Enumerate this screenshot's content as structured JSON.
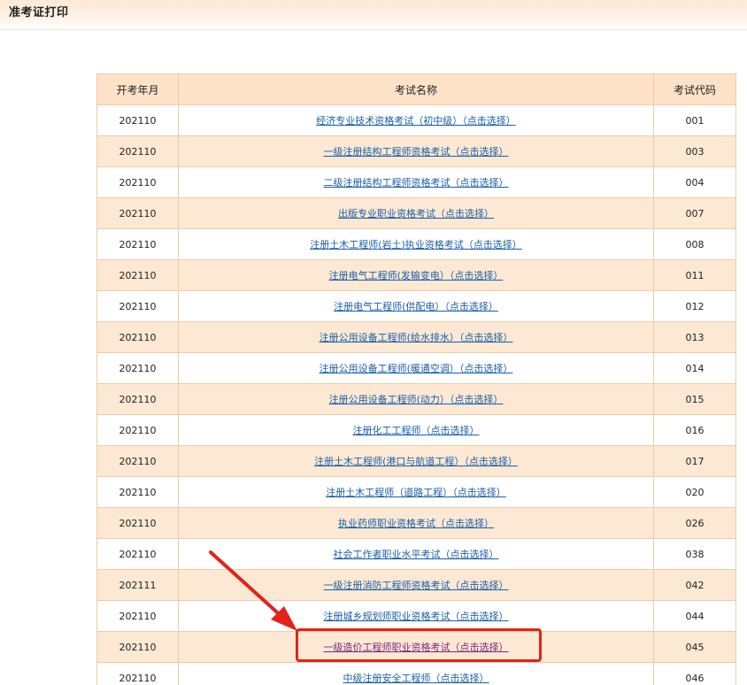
{
  "page": {
    "title": "准考证打印"
  },
  "table": {
    "headers": {
      "month": "开考年月",
      "name": "考试名称",
      "code": "考试代码"
    },
    "rows": [
      {
        "month": "202110",
        "name": "经济专业技术资格考试（初中级）（点击选择）",
        "code": "001"
      },
      {
        "month": "202110",
        "name": "一级注册结构工程师资格考试（点击选择）",
        "code": "003"
      },
      {
        "month": "202110",
        "name": "二级注册结构工程师资格考试（点击选择）",
        "code": "004"
      },
      {
        "month": "202110",
        "name": "出版专业职业资格考试（点击选择）",
        "code": "007"
      },
      {
        "month": "202110",
        "name": "注册土木工程师(岩土)执业资格考试（点击选择）",
        "code": "008"
      },
      {
        "month": "202110",
        "name": "注册电气工程师(发输变电）（点击选择）",
        "code": "011"
      },
      {
        "month": "202110",
        "name": "注册电气工程师(供配电）（点击选择）",
        "code": "012"
      },
      {
        "month": "202110",
        "name": "注册公用设备工程师(给水排水）（点击选择）",
        "code": "013"
      },
      {
        "month": "202110",
        "name": "注册公用设备工程师(暖通空调）（点击选择）",
        "code": "014"
      },
      {
        "month": "202110",
        "name": "注册公用设备工程师(动力）（点击选择）",
        "code": "015"
      },
      {
        "month": "202110",
        "name": "注册化工工程师（点击选择）",
        "code": "016"
      },
      {
        "month": "202110",
        "name": "注册土木工程师(港口与航道工程）（点击选择）",
        "code": "017"
      },
      {
        "month": "202110",
        "name": "注册土木工程师（道路工程）（点击选择）",
        "code": "020"
      },
      {
        "month": "202110",
        "name": "执业药师职业资格考试（点击选择）",
        "code": "026"
      },
      {
        "month": "202110",
        "name": "社会工作者职业水平考试（点击选择）",
        "code": "038"
      },
      {
        "month": "202111",
        "name": "一级注册消防工程师资格考试（点击选择）",
        "code": "042"
      },
      {
        "month": "202110",
        "name": "注册城乡规划师职业资格考试（点击选择）",
        "code": "044"
      },
      {
        "month": "202110",
        "name": "一级造价工程师职业资格考试（点击选择）",
        "code": "045"
      },
      {
        "month": "202110",
        "name": "中级注册安全工程师（点击选择）",
        "code": "046"
      }
    ]
  },
  "annotation": {
    "highlighted_code": "045",
    "color": "#e2231a"
  },
  "colors": {
    "header_bg": "#fde2c8",
    "row_alt_bg": "#fde8d4",
    "border": "#f0cba6",
    "link": "#1a5fa8",
    "link_visited": "#7a2a7a"
  }
}
